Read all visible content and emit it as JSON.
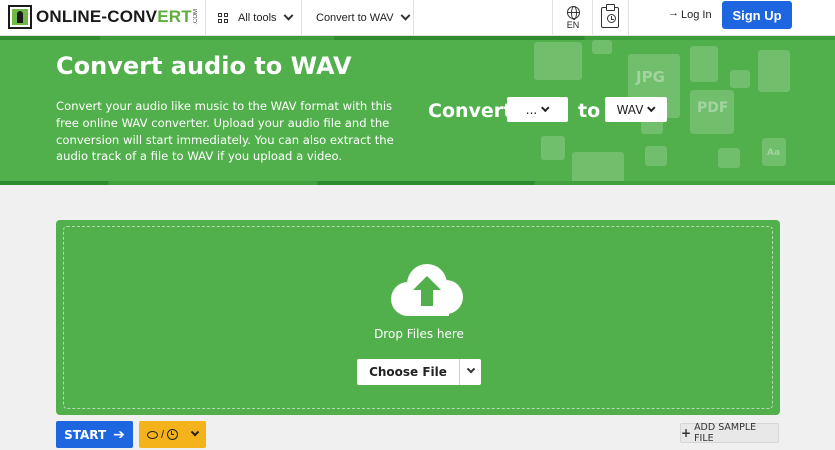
{
  "header": {
    "logo_text_a": "ONLINE-CONV",
    "logo_text_b": "ERT",
    "logo_com": ".COM",
    "all_tools": "All tools",
    "convert_to": "Convert to WAV",
    "lang": "EN",
    "login": "Log In",
    "signup": "Sign Up"
  },
  "banner": {
    "title": "Convert audio to WAV",
    "description": "Convert your audio like music to the WAV format with this free online WAV converter. Upload your audio file and the conversion will start immediately. You can also extract the audio track of a file to WAV if you upload a video.",
    "convert_label": "Convert",
    "from_value": "...",
    "to_label": "to",
    "to_value": "WAV"
  },
  "dropzone": {
    "drop_text": "Drop Files here",
    "choose_file": "Choose File"
  },
  "actions": {
    "start": "START",
    "add_sample": "ADD SAMPLE FILE"
  },
  "icons": {
    "tools": "grid-icon",
    "language": "globe-icon",
    "history": "clipboard-clock-icon",
    "login": "login-arrow-icon",
    "upload": "cloud-upload-icon",
    "credits": "coin-icon",
    "time": "clock-icon"
  },
  "colors": {
    "brand_green": "#52b04c",
    "primary_blue": "#1d66e0",
    "credits_yellow": "#f5b31b"
  }
}
